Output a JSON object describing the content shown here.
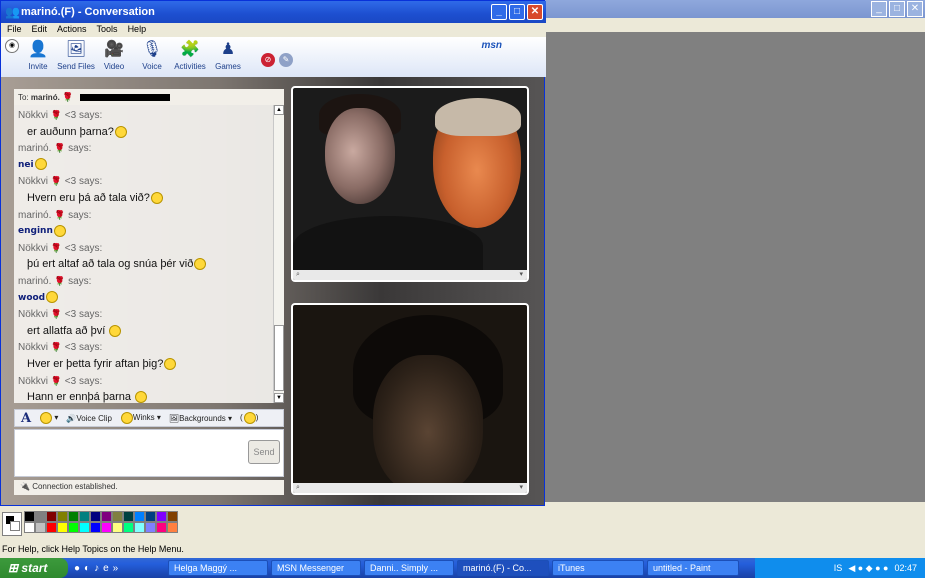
{
  "msn": {
    "title": "marinó.(F) - Conversation",
    "menu": [
      "File",
      "Edit",
      "Actions",
      "Tools",
      "Help"
    ],
    "toolbar": [
      {
        "label": "Invite",
        "icon": "invite-icon"
      },
      {
        "label": "Send Files",
        "icon": "send-files-icon"
      },
      {
        "label": "Video",
        "icon": "video-icon"
      },
      {
        "label": "Voice",
        "icon": "voice-icon"
      },
      {
        "label": "Activities",
        "icon": "activities-icon"
      },
      {
        "label": "Games",
        "icon": "games-icon"
      }
    ],
    "logo": "msn",
    "to_prefix": "To:",
    "to_name": "marinó.",
    "messages": [
      {
        "type": "says",
        "text": "Nökkvi ",
        "suffix": " <3 says:"
      },
      {
        "type": "text",
        "text": "er auðunn þarna?",
        "smile": true
      },
      {
        "type": "says",
        "text": "marinó. ",
        "suffix": " says:"
      },
      {
        "type": "bold",
        "text": "nei",
        "smile": true
      },
      {
        "type": "says",
        "text": "Nökkvi ",
        "suffix": " <3 says:"
      },
      {
        "type": "text",
        "text": "Hvern eru þá að tala við?",
        "smile": true
      },
      {
        "type": "says",
        "text": "marinó. ",
        "suffix": " says:"
      },
      {
        "type": "bold",
        "text": "enginn",
        "smile": true
      },
      {
        "type": "says",
        "text": "Nökkvi ",
        "suffix": " <3 says:"
      },
      {
        "type": "text",
        "text": "þú ert altaf að tala og snúa þér við",
        "smile": true
      },
      {
        "type": "says",
        "text": "marinó. ",
        "suffix": " says:"
      },
      {
        "type": "bold",
        "text": "wood",
        "smile": true
      },
      {
        "type": "says",
        "text": "Nökkvi ",
        "suffix": " <3 says:"
      },
      {
        "type": "text",
        "text": "ert allatfa að því ",
        "smile": true
      },
      {
        "type": "says",
        "text": "Nökkvi ",
        "suffix": " <3 says:"
      },
      {
        "type": "text",
        "text": "Hver er þetta fyrir aftan þig?",
        "smile": true
      },
      {
        "type": "says",
        "text": "Nökkvi ",
        "suffix": " <3 says:"
      },
      {
        "type": "text",
        "text": "Hann er ennþá þarna ",
        "smile": true
      }
    ],
    "format_bar": {
      "font": "A",
      "voice_clip": "Voice Clip",
      "winks": "Winks",
      "backgrounds": "Backgrounds"
    },
    "send_label": "Send",
    "status": "Connection established."
  },
  "paint": {
    "status": "For Help, click Help Topics on the Help Menu.",
    "palette": [
      "#000000",
      "#808080",
      "#800000",
      "#808000",
      "#008000",
      "#008080",
      "#000080",
      "#800080",
      "#808040",
      "#004040",
      "#0080ff",
      "#004080",
      "#8000ff",
      "#804000",
      "#ffffff",
      "#c0c0c0",
      "#ff0000",
      "#ffff00",
      "#00ff00",
      "#00ffff",
      "#0000ff",
      "#ff00ff",
      "#ffff80",
      "#00ff80",
      "#80ffff",
      "#8080ff",
      "#ff0080",
      "#ff8040"
    ]
  },
  "taskbar": {
    "start": "start",
    "tasks": [
      {
        "label": "Helga Maggý ...",
        "active": false
      },
      {
        "label": "MSN Messenger",
        "active": false
      },
      {
        "label": "Danni.. Simply ...",
        "active": false
      },
      {
        "label": "marinó.(F) - Co...",
        "active": true
      },
      {
        "label": "iTunes",
        "active": false
      },
      {
        "label": "untitled - Paint",
        "active": false
      }
    ],
    "lang": "IS",
    "clock": "02:47"
  }
}
